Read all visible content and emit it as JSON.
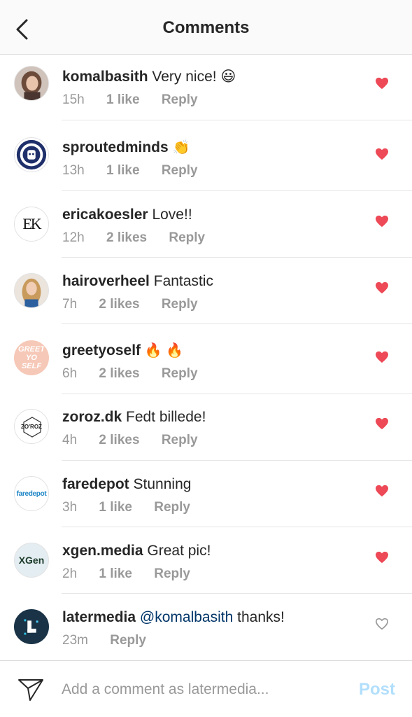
{
  "header": {
    "title": "Comments",
    "back_icon": "chevron-left-icon"
  },
  "colors": {
    "heart_active": "#ed4956",
    "link": "#003569",
    "post_disabled": "#b2dffc",
    "meta_gray": "#999999"
  },
  "comments": [
    {
      "username": "komalbasith",
      "text": "Very nice! 😃",
      "time": "15h",
      "likes": "1 like",
      "reply": "Reply",
      "liked": true
    },
    {
      "username": "sproutedminds",
      "text": "👏",
      "time": "13h",
      "likes": "1 like",
      "reply": "Reply",
      "liked": true
    },
    {
      "username": "ericakoesler",
      "text": "Love!!",
      "time": "12h",
      "likes": "2 likes",
      "reply": "Reply",
      "liked": true
    },
    {
      "username": "hairoverheel",
      "text": "Fantastic",
      "time": "7h",
      "likes": "2 likes",
      "reply": "Reply",
      "liked": true
    },
    {
      "username": "greetyoself",
      "text": "🔥 🔥",
      "time": "6h",
      "likes": "2 likes",
      "reply": "Reply",
      "liked": true
    },
    {
      "username": "zoroz.dk",
      "text": "Fedt billede!",
      "time": "4h",
      "likes": "2 likes",
      "reply": "Reply",
      "liked": true
    },
    {
      "username": "faredepot",
      "text": "Stunning",
      "time": "3h",
      "likes": "1 like",
      "reply": "Reply",
      "liked": true
    },
    {
      "username": "xgen.media",
      "text": "Great pic!",
      "time": "2h",
      "likes": "1 like",
      "reply": "Reply",
      "liked": true
    },
    {
      "username": "latermedia",
      "mention": "@komalbasith",
      "text": "thanks!",
      "time": "23m",
      "reply": "Reply",
      "liked": false
    }
  ],
  "avatars": {
    "ericakoesler": "EK",
    "greetyoself": "GREET YO SELF",
    "zoroz": "ZO'ROZ",
    "faredepot": "faredepot",
    "xgen": "XGen"
  },
  "composer": {
    "placeholder": "Add a comment as latermedia...",
    "post_label": "Post",
    "send_icon": "paper-plane-icon"
  }
}
